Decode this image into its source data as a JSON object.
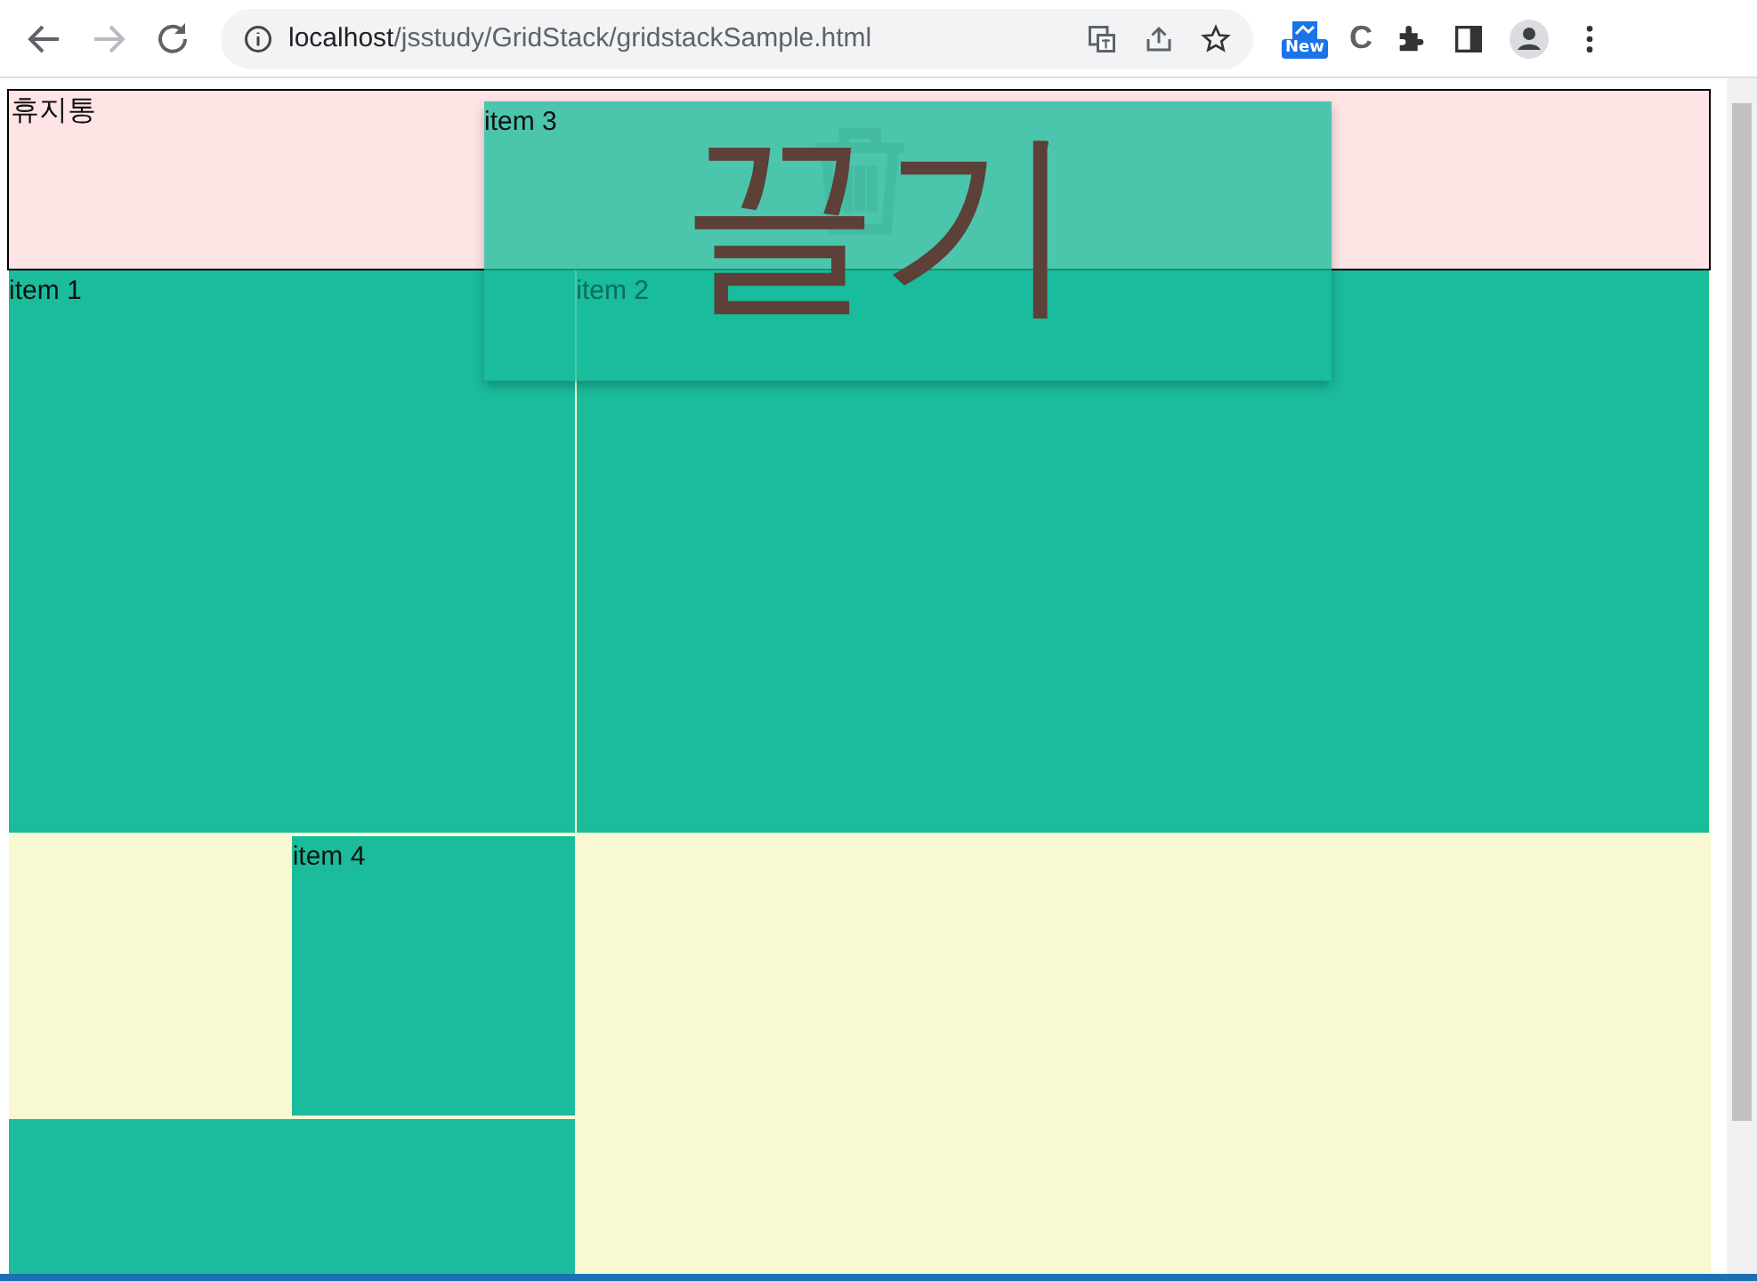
{
  "browser": {
    "back": {
      "disabled": false
    },
    "forward": {
      "disabled": true
    },
    "url_host": "localhost",
    "url_path": "/jsstudy/GridStack/gridstackSample.html",
    "extension_badge": "New",
    "extension_letter": "C"
  },
  "trash": {
    "label": "휴지통"
  },
  "grid": {
    "items": [
      {
        "kind": "labeled",
        "label": "item 1"
      },
      {
        "kind": "labeled",
        "label": "item 2"
      },
      {
        "kind": "labeled",
        "label": "item 4"
      },
      {
        "kind": "blank"
      }
    ]
  },
  "dragged_item": {
    "label": "item 3"
  },
  "annotation": {
    "text": "끌기"
  }
}
